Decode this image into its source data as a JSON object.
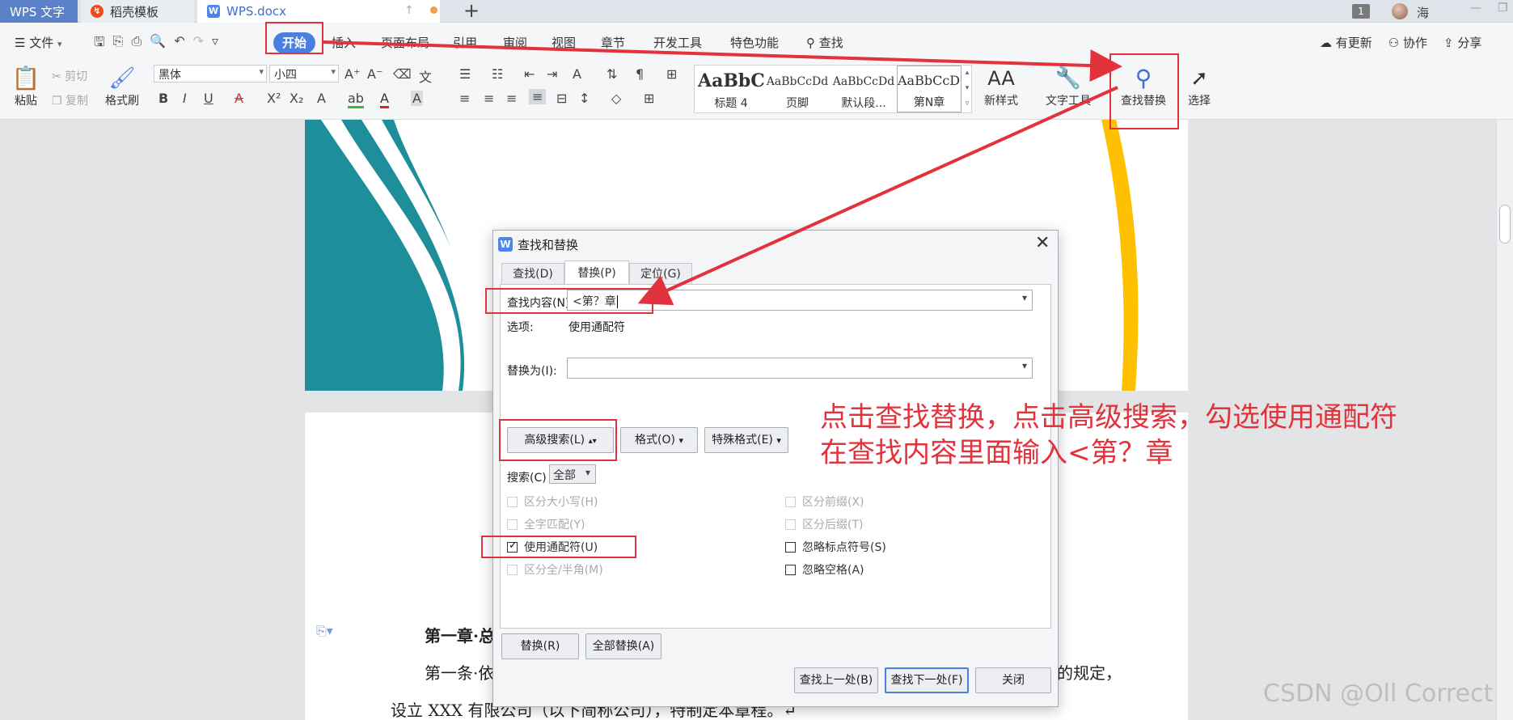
{
  "tabs": {
    "app": "WPS 文字",
    "template": "稻壳模板",
    "doc": "WPS.docx",
    "new": "+",
    "count": "1",
    "user": "海"
  },
  "menu": {
    "file": "文件",
    "start": "开始",
    "items": [
      "插入",
      "页面布局",
      "引用",
      "审阅",
      "视图",
      "章节",
      "开发工具",
      "特色功能",
      "查找"
    ],
    "right": [
      "有更新",
      "协作",
      "分享"
    ]
  },
  "ribbon": {
    "paste": "粘贴",
    "cut": "剪切",
    "copy": "复制",
    "format_painter": "格式刷",
    "font": "黑体",
    "size": "小四",
    "styles": [
      {
        "sample": "AaBbC",
        "label": "标题 4"
      },
      {
        "sample": "AaBbCcDd",
        "label": "页脚"
      },
      {
        "sample": "AaBbCcDd",
        "label": "默认段..."
      },
      {
        "sample": "AaBbCcDc",
        "label": "第N章"
      }
    ],
    "new_style": "新样式",
    "text_tools": "文字工具",
    "find_replace": "查找替换",
    "select": "选择"
  },
  "document": {
    "heading": "第一章·总",
    "line1": "第一条·依",
    "line1_end": "的规定，",
    "line2": "设立 XXX 有限公司（以下简称公司），特制定本章程。↵"
  },
  "dialog": {
    "title": "查找和替换",
    "tabs": [
      "查找(D)",
      "替换(P)",
      "定位(G)"
    ],
    "find_label": "查找内容(N):",
    "find_value": "<第？章",
    "options_label": "选项:",
    "options_value": "使用通配符",
    "replace_label": "替换为(I):",
    "replace_value": "",
    "advanced": "高级搜索(L)",
    "format": "格式(O)",
    "special": "特殊格式(E)",
    "search_label": "搜索(C)",
    "search_value": "全部",
    "checks_left": [
      "区分大小写(H)",
      "全字匹配(Y)",
      "使用通配符(U)",
      "区分全/半角(M)"
    ],
    "checks_right": [
      "区分前缀(X)",
      "区分后缀(T)",
      "忽略标点符号(S)",
      "忽略空格(A)"
    ],
    "replace_btn": "替换(R)",
    "replace_all": "全部替换(A)",
    "find_prev": "查找上一处(B)",
    "find_next": "查找下一处(F)",
    "close": "关闭"
  },
  "annotation": {
    "line1": "点击查找替换，点击高级搜索，勾选使用通配符",
    "line2": "在查找内容里面输入<第？章"
  },
  "watermark": "CSDN @Oll Correct",
  "colors": {
    "accent": "#4a7ee0",
    "annotation": "#e2323b",
    "teal": "#1e8f9a",
    "gold": "#ffc000"
  }
}
